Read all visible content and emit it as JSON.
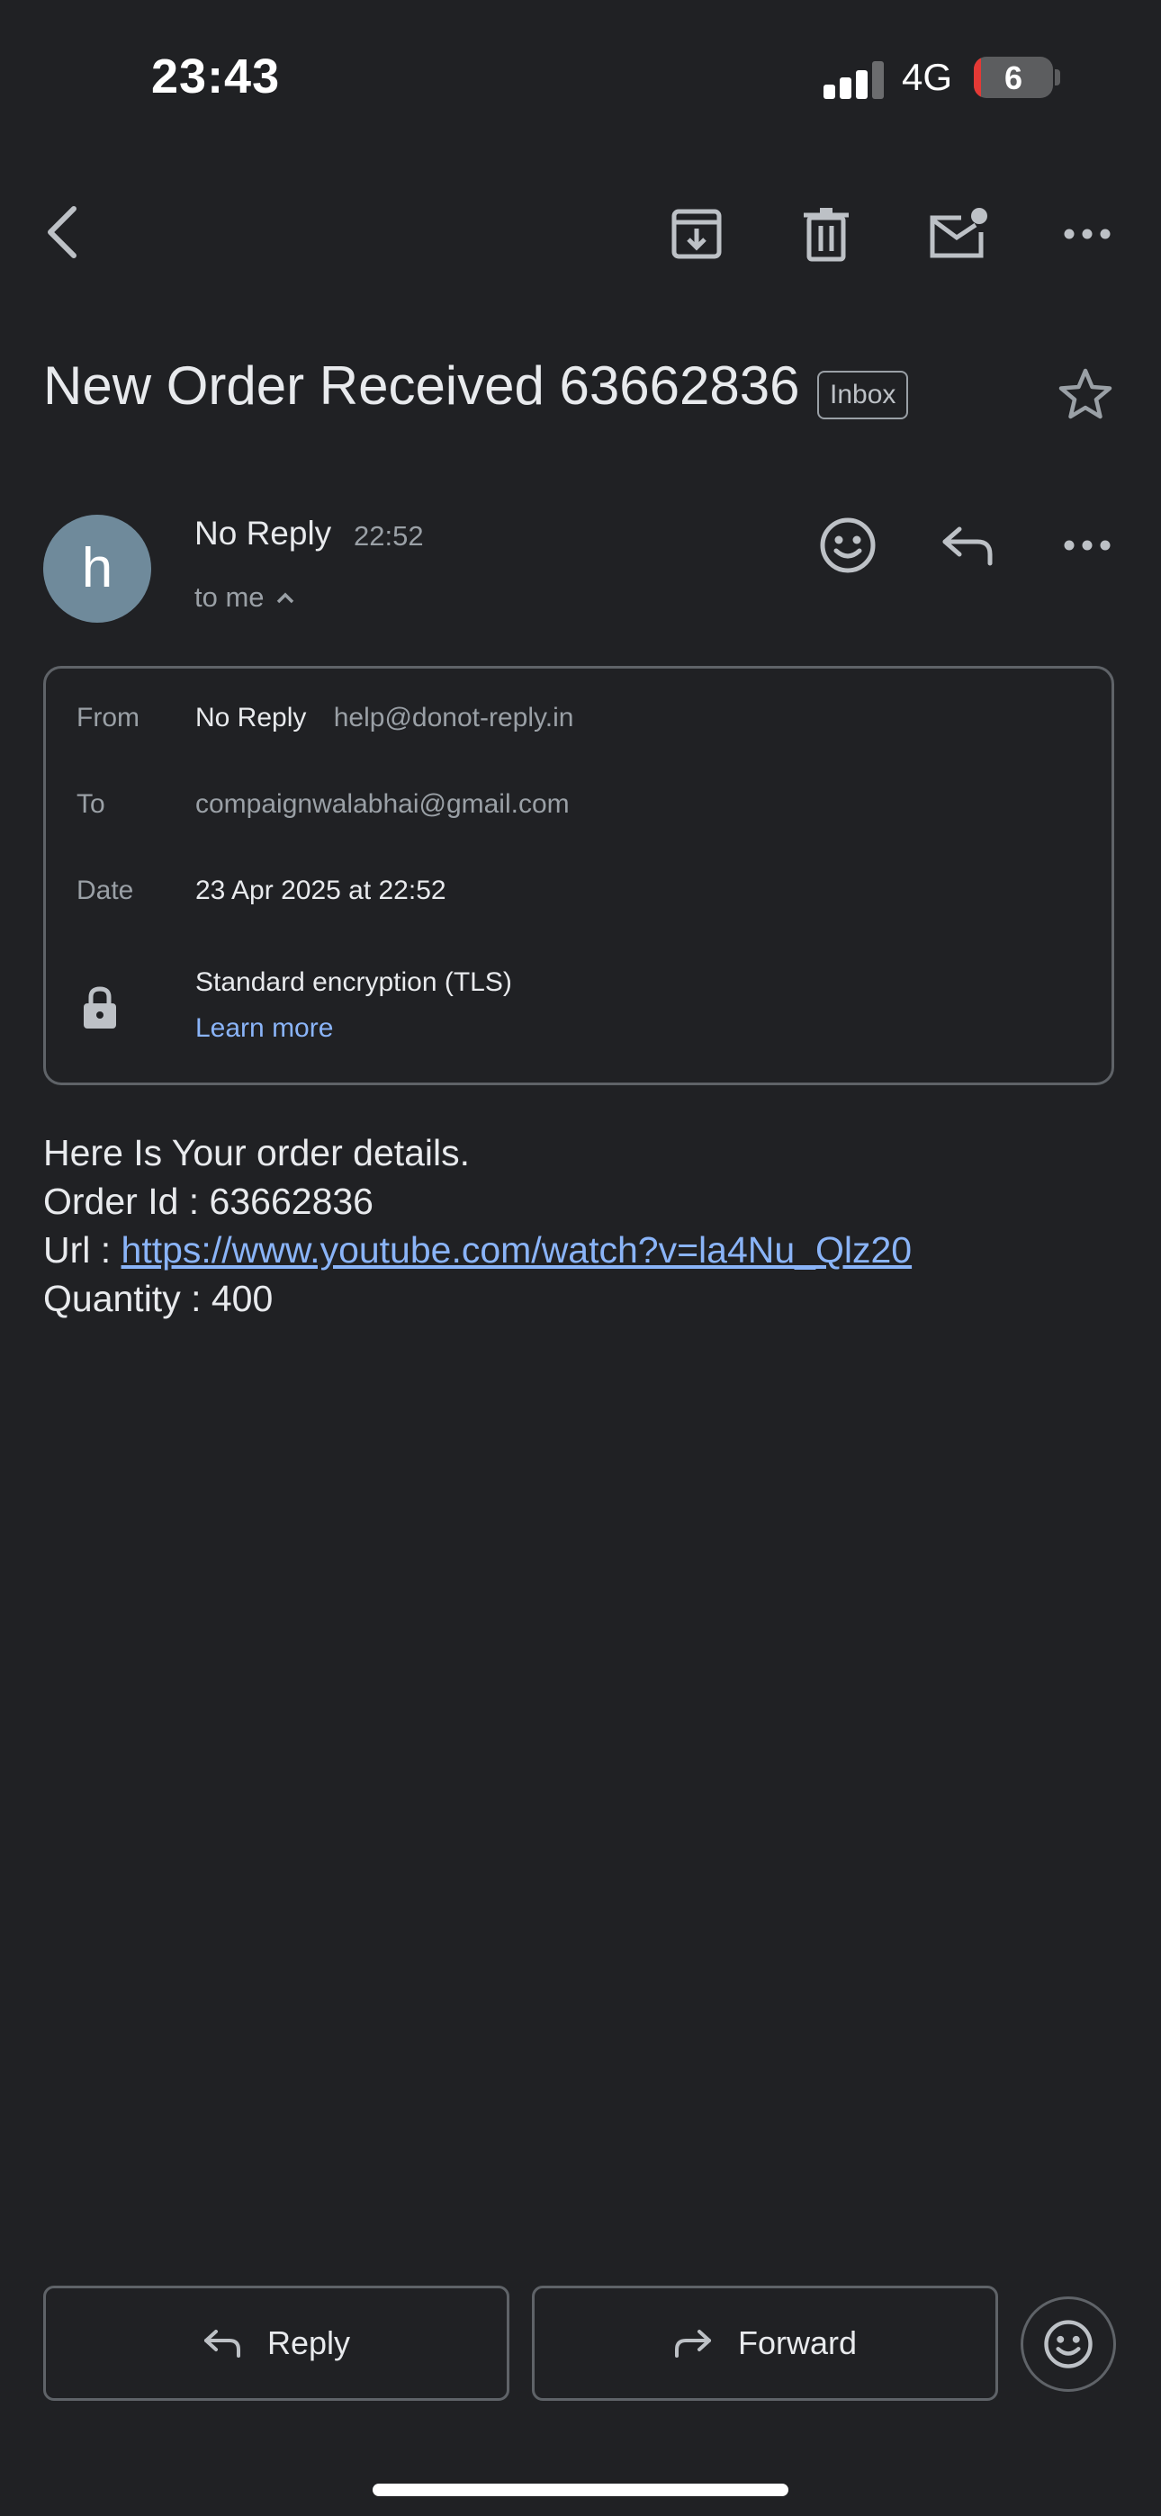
{
  "status_bar": {
    "time": "23:43",
    "network": "4G",
    "battery": "6",
    "battery_color": "#e53935"
  },
  "toolbar": {
    "icons": [
      "back-arrow-icon",
      "archive-icon",
      "trash-icon",
      "mark-unread-icon",
      "more-icon"
    ]
  },
  "email": {
    "subject": "New Order Received 63662836",
    "label": "Inbox",
    "sender": {
      "avatar_letter": "h",
      "avatar_color": "#6f8a9b",
      "name": "No Reply",
      "time": "22:52",
      "recipient_summary": "to me"
    },
    "details": {
      "from_label": "From",
      "from_name": "No Reply",
      "from_email": "help@donot-reply.in",
      "to_label": "To",
      "to_email": "compaignwalabhai@gmail.com",
      "date_label": "Date",
      "date_value": "23 Apr 2025 at 22:52",
      "encryption": "Standard encryption (TLS)",
      "learn_more": "Learn more"
    },
    "body": {
      "line1": "Here Is Your order details.",
      "line2": "Order Id : 63662836",
      "url_label": "Url : ",
      "url": "https://www.youtube.com/watch?v=la4Nu_Qlz20",
      "line4": "Quantity : 400"
    }
  },
  "actions": {
    "reply": "Reply",
    "forward": "Forward"
  },
  "colors": {
    "background": "#202124",
    "link": "#8ab4f8",
    "border": "#5f6368"
  }
}
